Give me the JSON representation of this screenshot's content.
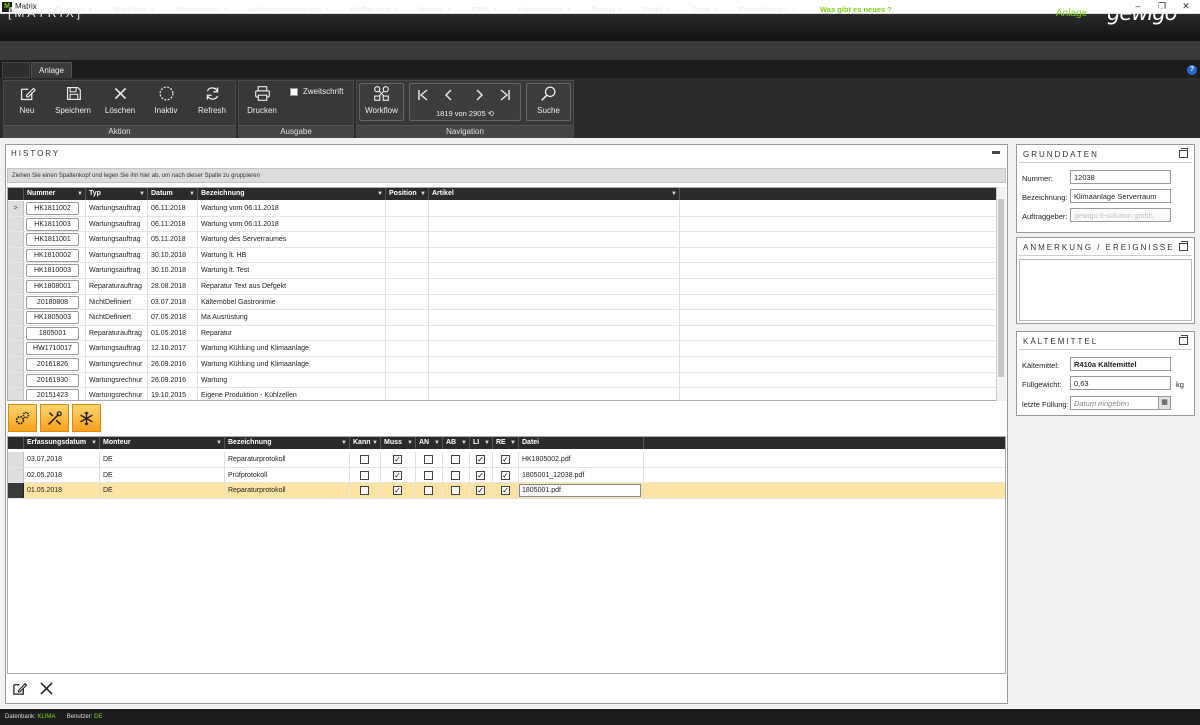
{
  "window": {
    "title": "Matrix",
    "logo": "Matrix app icon",
    "minimize": "–",
    "restore": "❐",
    "close": "✕"
  },
  "brand": {
    "logo_text": "[MATRIX]",
    "context": "Anlage",
    "company_logo": "gewigo"
  },
  "menu": [
    {
      "label": "Neu",
      "dropdown": true
    },
    {
      "label": "Drucken",
      "dropdown": true
    },
    {
      "label": "Workflow",
      "dropdown": true
    },
    {
      "label": "Stammdaten",
      "dropdown": true
    },
    {
      "label": "Auftragsbearbeitung",
      "dropdown": true
    },
    {
      "label": "BinPacking",
      "dropdown": true
    },
    {
      "label": "Service",
      "dropdown": true
    },
    {
      "label": "CRM",
      "dropdown": true
    },
    {
      "label": "Preisanfrage",
      "dropdown": true
    },
    {
      "label": "Tender",
      "dropdown": true
    },
    {
      "label": "Profit",
      "dropdown": true
    },
    {
      "label": "Capa",
      "dropdown": true
    },
    {
      "label": "Einstellungen",
      "dropdown": true
    },
    {
      "label": "Was gibt es neues ?",
      "dropdown": false
    }
  ],
  "tabs": {
    "active": "Anlage",
    "help": "?"
  },
  "ribbon": {
    "aktion": {
      "label": "Aktion",
      "neu": "Neu",
      "speichern": "Speichern",
      "loeschen": "Löschen",
      "inaktiv": "Inaktiv",
      "refresh": "Refresh"
    },
    "ausgabe": {
      "label": "Ausgabe",
      "drucken": "Drucken",
      "zweitschrift": "Zweitschrift"
    },
    "navigation": {
      "label": "Navigation",
      "workflow": "Workflow",
      "record": "1819 von 2905",
      "suche": "Suche"
    }
  },
  "history": {
    "title": "HISTORY",
    "group_hint": "Ziehen Sie einen Spaltenkopf und legen Sie ihn hier ab, um nach dieser Spalte zu gruppieren",
    "columns": [
      "Nummer",
      "Typ",
      "Datum",
      "Bezeichnung",
      "Position",
      "Artikel"
    ],
    "rows": [
      {
        "nummer": "HK1811002",
        "typ": "Wartungsauftrag",
        "datum": "06.11.2018",
        "bez": "Wartung vom 06.11.2018",
        "current": true
      },
      {
        "nummer": "HK1811003",
        "typ": "Wartungsauftrag",
        "datum": "06.11.2018",
        "bez": "Wartung vom 06.11.2018"
      },
      {
        "nummer": "HK1811001",
        "typ": "Wartungsauftrag",
        "datum": "05.11.2018",
        "bez": "Wartung des Serverraumes"
      },
      {
        "nummer": "HK1810002",
        "typ": "Wartungsauftrag",
        "datum": "30.10.2018",
        "bez": "Wartung lt. HB"
      },
      {
        "nummer": "HK1810003",
        "typ": "Wartungsauftrag",
        "datum": "30.10.2018",
        "bez": "Wartung lt. Test"
      },
      {
        "nummer": "HK1808001",
        "typ": "Reparaturauftrag",
        "datum": "28.08.2018",
        "bez": "Reparatur Text aus Defgekt"
      },
      {
        "nummer": "20180808",
        "typ": "NichtDefiniert",
        "datum": "03.07.2018",
        "bez": "Kältemöbel Gastronimie"
      },
      {
        "nummer": "HK1805003",
        "typ": "NichtDefiniert",
        "datum": "07.05.2018",
        "bez": "Ma Ausrüstung"
      },
      {
        "nummer": "1805001",
        "typ": "Reparaturauftrag",
        "datum": "01.05.2018",
        "bez": "Reparatur"
      },
      {
        "nummer": "HW1710017",
        "typ": "Wartungsauftrag",
        "datum": "12.10.2017",
        "bez": "Wartung Kühlung und Klimaanlage"
      },
      {
        "nummer": "20161826",
        "typ": "Wartungsrechnur",
        "datum": "26.09.2016",
        "bez": "Wartung Kühlung und Klimaanlage"
      },
      {
        "nummer": "20161930",
        "typ": "Wartungsrechnur",
        "datum": "26.09.2016",
        "bez": "Wartung"
      },
      {
        "nummer": "20151423",
        "typ": "Wartungsrechnur",
        "datum": "19.10.2015",
        "bez": "Eigene Produktion - Kühlzellen"
      }
    ]
  },
  "icon_tabs": [
    "settings-gears-icon",
    "tools-icon",
    "snowflake-icon"
  ],
  "protocols": {
    "columns": [
      "Erfassungsdatum",
      "Monteur",
      "Bezeichnung",
      "Kann",
      "Muss",
      "AN",
      "AB",
      "LI",
      "RE",
      "Datei"
    ],
    "rows": [
      {
        "datum": "03.07.2018",
        "monteur": "DE",
        "bez": "Reparaturprotokoll",
        "kann": false,
        "muss": true,
        "an": false,
        "ab": false,
        "li": true,
        "re": true,
        "datei": "HK1805002.pdf"
      },
      {
        "datum": "02.05.2018",
        "monteur": "DE",
        "bez": "Prüfprotokoll",
        "kann": false,
        "muss": true,
        "an": false,
        "ab": false,
        "li": true,
        "re": true,
        "datei": "1805001_12038.pdf"
      },
      {
        "datum": "01.05.2018",
        "monteur": "DE",
        "bez": "Reparaturprotokoll",
        "kann": false,
        "muss": true,
        "an": false,
        "ab": false,
        "li": true,
        "re": true,
        "datei": "1805001.pdf",
        "selected": true
      }
    ],
    "check_mark": "✓"
  },
  "grunddaten": {
    "title": "GRUNDDATEN",
    "nummer_label": "Nummer:",
    "nummer": "12038",
    "bez_label": "Bezeichnung:",
    "bez": "Klimaanlage Serverraum",
    "auftraggeber_label": "Auftraggeber:",
    "auftraggeber": "gewigo it-solution gmbh"
  },
  "anmerkung": {
    "title": "ANMERKUNG / EREIGNISSE"
  },
  "kaeltemittel": {
    "title": "KÄLTEMITTEL",
    "km_label": "Kältemittel:",
    "km": "R410a Kältemittel",
    "gewicht_label": "Füllgewicht:",
    "gewicht": "0,63",
    "unit": "kg",
    "fuellung_label": "letzte Füllung:",
    "fuellung_placeholder": "Datum eingeben"
  },
  "status": {
    "db_label": "Datenbank:",
    "db": "KLIMA",
    "user_label": "Benutzer:",
    "user": "DE"
  },
  "colors": {
    "accent": "#7cd21e",
    "dark": "#2b2b2b",
    "highlight_row": "#fde4a5",
    "orange_tab": "#f6a21c"
  }
}
